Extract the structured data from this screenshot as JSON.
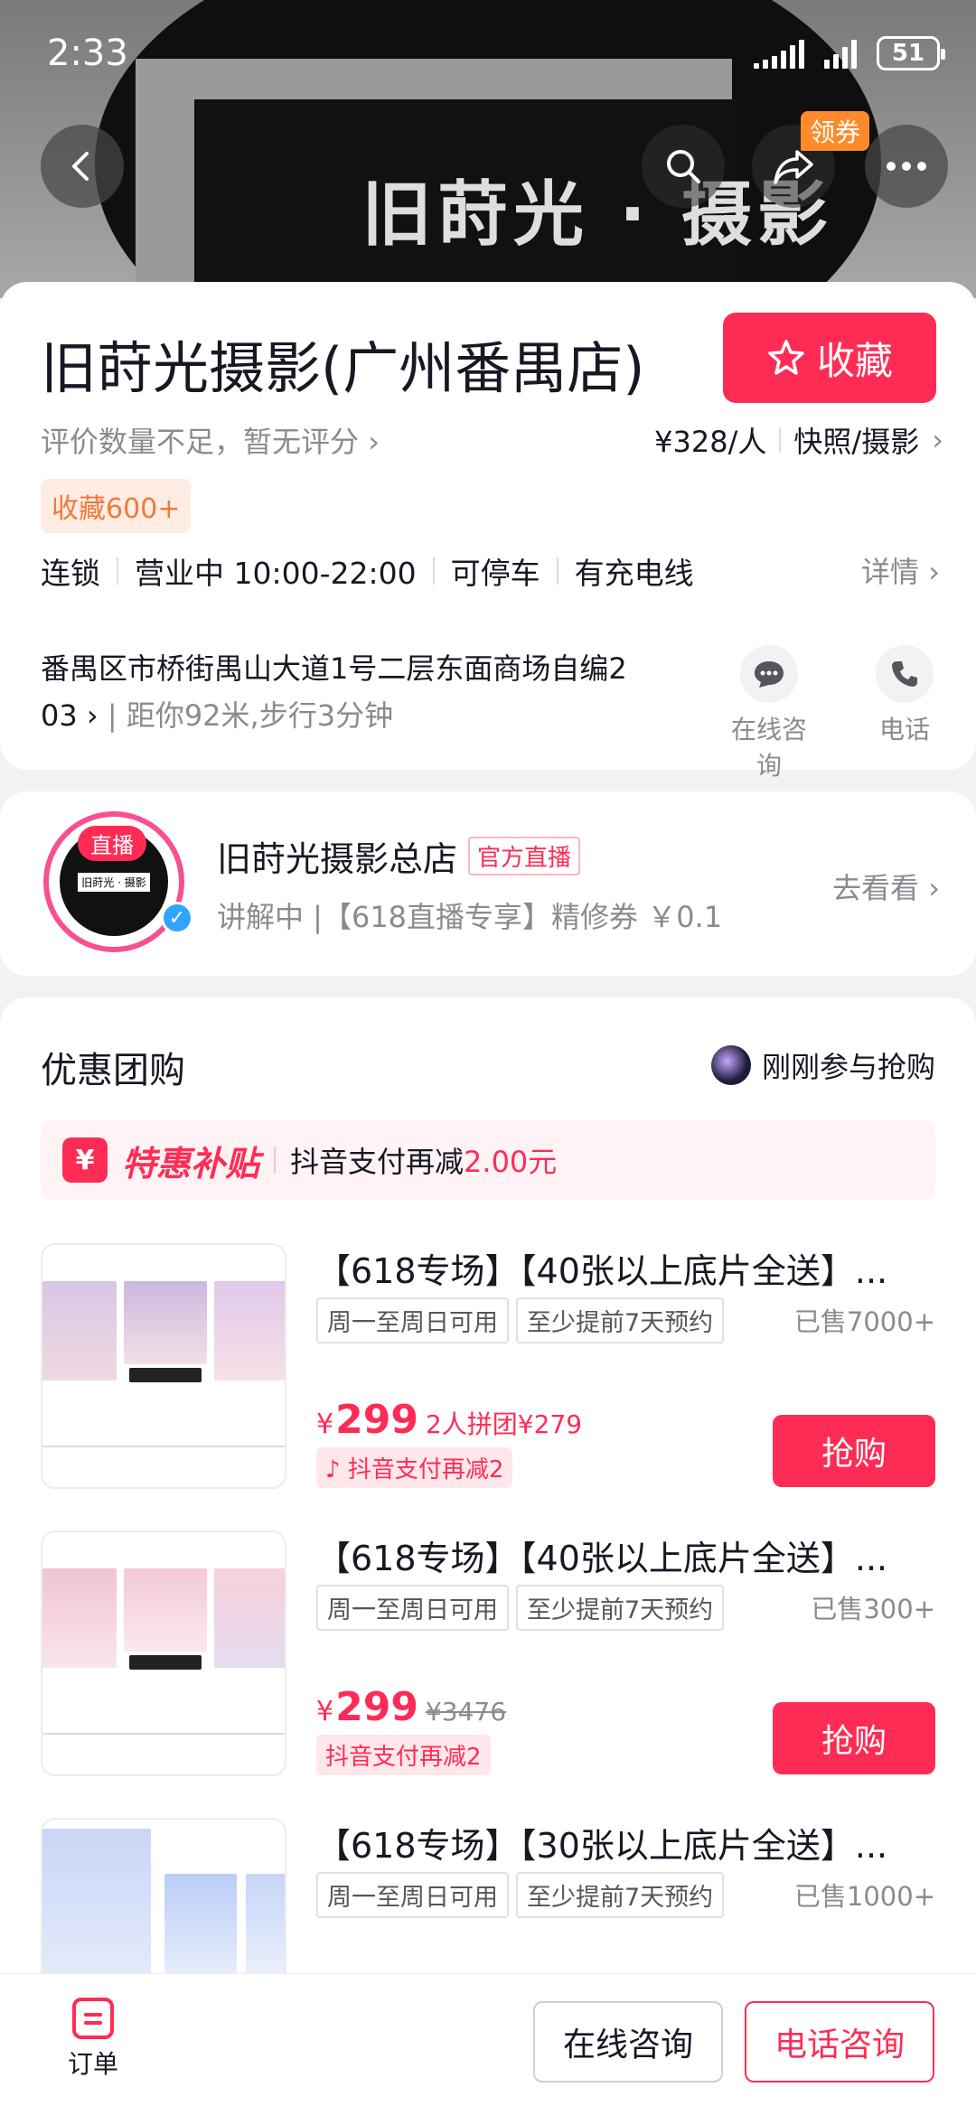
{
  "status": {
    "time": "2:33",
    "battery": "51"
  },
  "hero": {
    "logo_text": "旧莳光 · 摄影",
    "coupon_tag": "领券"
  },
  "store": {
    "title": "旧莳光摄影(广州番禺店)",
    "favorite_label": "收藏",
    "rating_text": "评价数量不足，暂无评分",
    "price": "¥328/人",
    "category": "快照/摄影",
    "favorite_count": "收藏600+",
    "info": [
      "连锁",
      "营业中 10:00-22:00",
      "可停车",
      "有充电线"
    ],
    "details_link": "详情",
    "address_line1": "番禺区市桥街禺山大道1号二层东面商场自编2",
    "address_line2": "03",
    "distance": "距你92米,步行3分钟",
    "consult_label": "在线咨询",
    "phone_label": "电话"
  },
  "live": {
    "badge": "直播",
    "name": "旧莳光摄影总店",
    "official_tag": "官方直播",
    "subtitle": "讲解中 |【618直播专享】精修券 ￥0.1",
    "go_watch": "去看看"
  },
  "deals": {
    "title": "优惠团购",
    "recent_text": "刚刚参与抢购",
    "subsidy_name": "特惠补贴",
    "subsidy_text": "抖音支付再减",
    "subsidy_amount": "2.00元",
    "items": [
      {
        "name": "【618专场】【40张以上底片全送】...",
        "tags": [
          "周一至周日可用",
          "至少提前7天预约"
        ],
        "sold": "已售7000+",
        "price": "299",
        "group_price": "2人拼团¥279",
        "pay_tag": "抖音支付再减2",
        "buy": "抢购"
      },
      {
        "name": "【618专场】【40张以上底片全送】...",
        "tags": [
          "周一至周日可用",
          "至少提前7天预约"
        ],
        "sold": "已售300+",
        "price": "299",
        "original_price": "¥3476",
        "pay_tag": "抖音支付再减2",
        "buy": "抢购"
      },
      {
        "name": "【618专场】【30张以上底片全送】...",
        "tags": [
          "周一至周日可用",
          "至少提前7天预约"
        ],
        "sold": "已售1000+"
      }
    ]
  },
  "bottom": {
    "order_label": "订单",
    "consult_button": "在线咨询",
    "phone_button": "电话咨询"
  },
  "colors": {
    "accent": "#fe2c55",
    "orange": "#ff8a2b",
    "muted": "#8a8b91"
  }
}
